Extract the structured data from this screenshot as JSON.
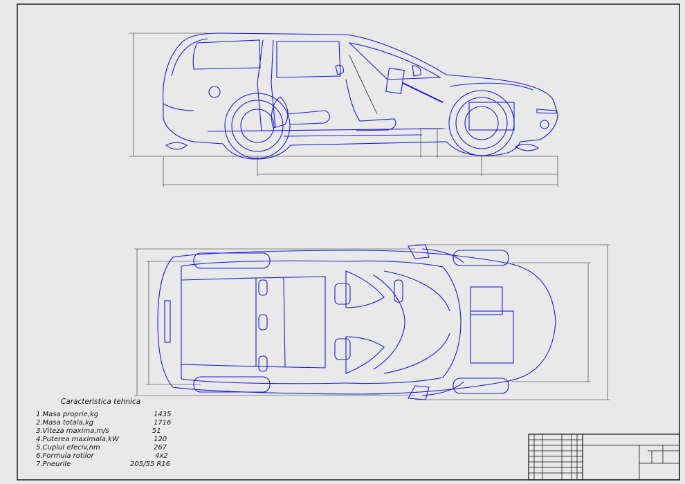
{
  "specs": {
    "title": "Caracteristica tehnica",
    "rows": [
      {
        "label": "1.Masa proprie,kg",
        "value": "1435"
      },
      {
        "label": "2.Masa totala,kg",
        "value": "1716"
      },
      {
        "label": "3.Viteza maxima,m/s",
        "value": "51"
      },
      {
        "label": "4.Puterea maximala,kW",
        "value": "120"
      },
      {
        "label": "5.Cuplul efeciv,nm",
        "value": "267"
      },
      {
        "label": "6.Formula rotilor",
        "value": "4x2"
      },
      {
        "label": "7.Pneurile",
        "value": "205/55 R16"
      }
    ]
  },
  "colors": {
    "line": "#1a1ad6",
    "dimension": "#222222",
    "background": "#e9e9e9"
  }
}
